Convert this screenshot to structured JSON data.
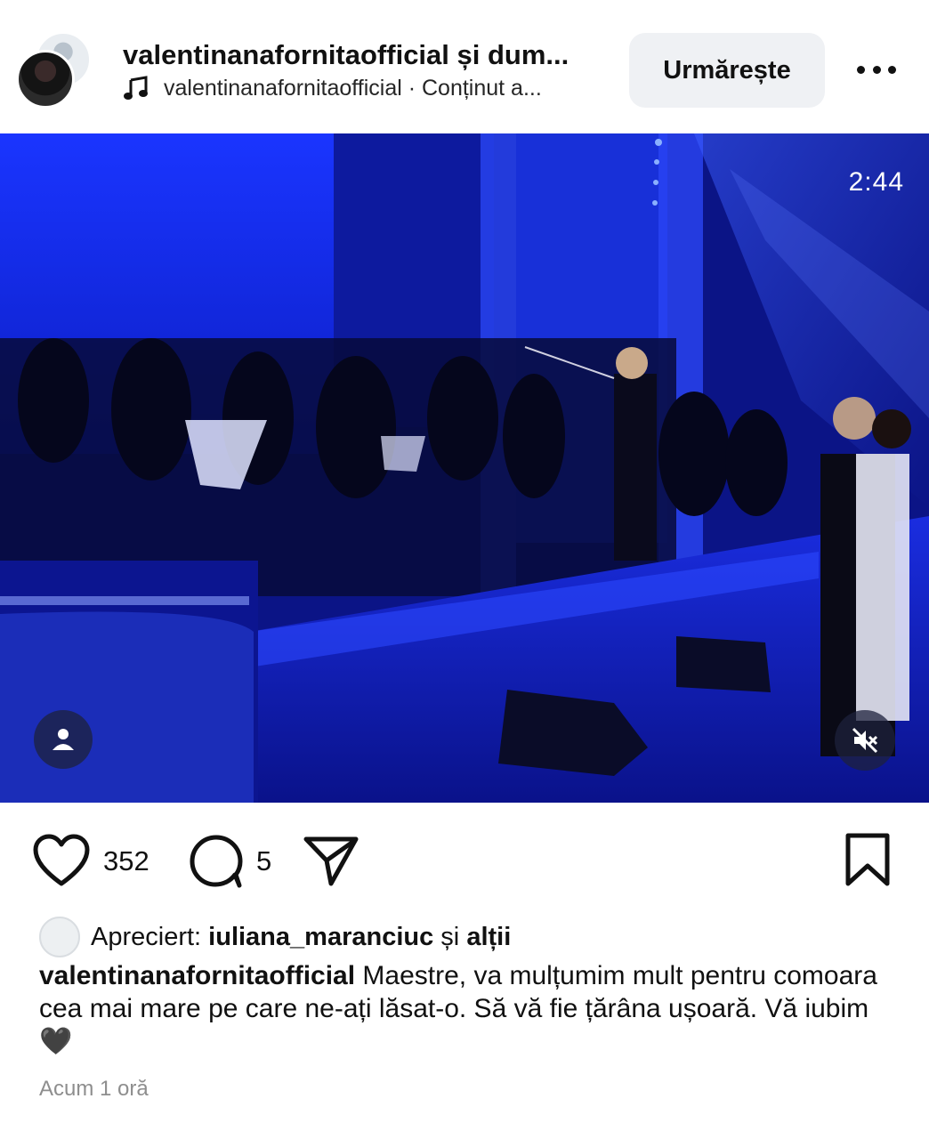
{
  "header": {
    "author": "valentinanafornitaofficial și dum...",
    "audio": "valentinanafornitaofficial · Conținut a...",
    "follow_label": "Urmărește"
  },
  "video": {
    "time_remaining": "2:44"
  },
  "actions": {
    "like_count": "352",
    "comment_count": "5"
  },
  "likes": {
    "prefix": "Apreciert:",
    "liker": "iuliana_maranciuc",
    "joiner": "și",
    "others": "alții"
  },
  "caption": {
    "username": "valentinanafornitaofficial",
    "text": "Maestre, va mulțumim mult pentru comoara cea mai mare pe care ne-ați lăsat-o. Să vă fie țărâna ușoară. Vă iubim 🖤"
  },
  "timestamp": "Acum 1 oră",
  "icons": {
    "music": "music-note-icon",
    "more": "more-options-icon",
    "user": "user-tag-icon",
    "mute": "muted-speaker-icon",
    "like": "heart-icon",
    "comment": "comment-bubble-icon",
    "share": "paper-plane-icon",
    "save": "bookmark-icon"
  },
  "colors": {
    "stage_blue": "#1020c8",
    "follow_bg": "#eff1f4",
    "timestamp_gray": "#8e8e8e"
  }
}
